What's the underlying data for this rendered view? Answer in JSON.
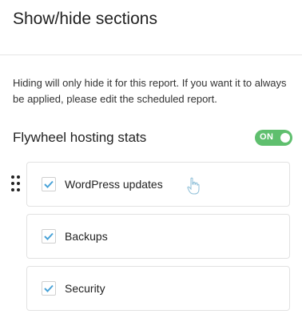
{
  "dialog": {
    "title": "Show/hide sections",
    "description": "Hiding will only hide it for this report. If you want it to always be applied, please edit the scheduled report."
  },
  "section": {
    "title": "Flywheel hosting stats",
    "toggle": {
      "label": "ON",
      "state": "on",
      "color": "#5fbf6e"
    }
  },
  "items": [
    {
      "label": "WordPress updates",
      "checked": true
    },
    {
      "label": "Backups",
      "checked": true
    },
    {
      "label": "Security",
      "checked": true
    }
  ],
  "colors": {
    "accent": "#4aa3d8"
  }
}
